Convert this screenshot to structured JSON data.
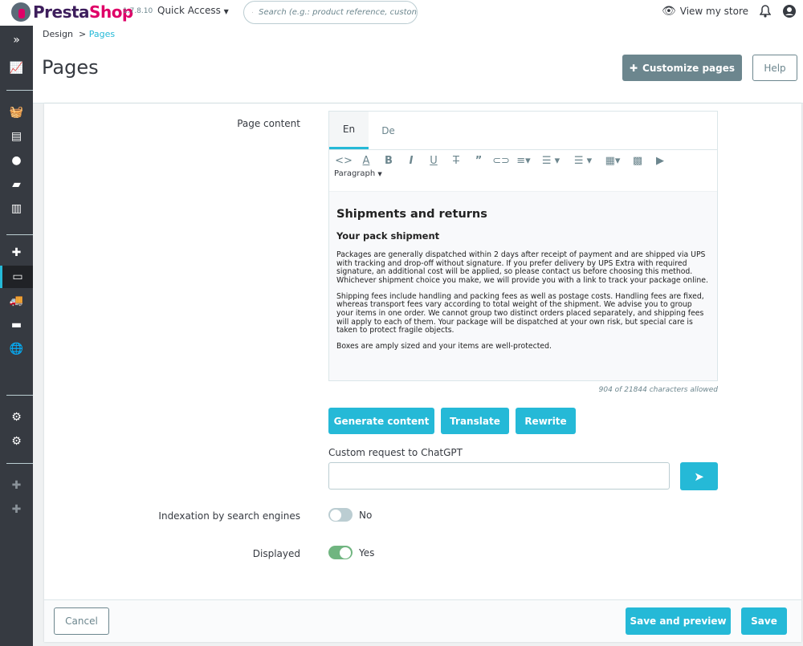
{
  "topbar": {
    "brand_a": "Presta",
    "brand_b": "Shop",
    "version": "1.7.8.10",
    "quick_access": "Quick Access",
    "search_placeholder": "Search (e.g.: product reference, custon",
    "view_store": "View my store"
  },
  "breadcrumb": {
    "parent": "Design",
    "separator": ">",
    "current": "Pages"
  },
  "header": {
    "title": "Pages",
    "customize": "Customize pages",
    "help": "Help"
  },
  "form": {
    "page_content_label": "Page content",
    "lang_tabs": [
      "En",
      "De"
    ],
    "paragraph": "Paragraph",
    "content": {
      "h1": "Shipments and returns",
      "h2": "Your pack shipment",
      "p1": "Packages are generally dispatched within 2 days after receipt of payment and are shipped via UPS with tracking and drop-off without signature. If you prefer delivery by UPS Extra with required signature, an additional cost will be applied, so please contact us before choosing this method. Whichever shipment choice you make, we will provide you with a link to track your package online.",
      "p2": "Shipping fees include handling and packing fees as well as postage costs. Handling fees are fixed, whereas transport fees vary according to total weight of the shipment. We advise you to group your items in one order. We cannot group two distinct orders placed separately, and shipping fees will apply to each of them. Your package will be dispatched at your own risk, but special care is taken to protect fragile objects.",
      "p3": "Boxes are amply sized and your items are well-protected."
    },
    "counter": "904 of 21844 characters allowed",
    "ai_buttons": [
      "Generate content",
      "Translate",
      "Rewrite"
    ],
    "chat_label": "Custom request to ChatGPT",
    "chat_value": "",
    "indexation_label": "Indexation by search engines",
    "indexation_value": "No",
    "indexation_on": false,
    "displayed_label": "Displayed",
    "displayed_value": "Yes",
    "displayed_on": true
  },
  "footer": {
    "cancel": "Cancel",
    "save_preview": "Save and preview",
    "save": "Save"
  },
  "colors": {
    "accent": "#25b9d7",
    "sidebar": "#363a41",
    "toggle_on": "#70b580",
    "toggle_off": "#bbcdd2"
  }
}
